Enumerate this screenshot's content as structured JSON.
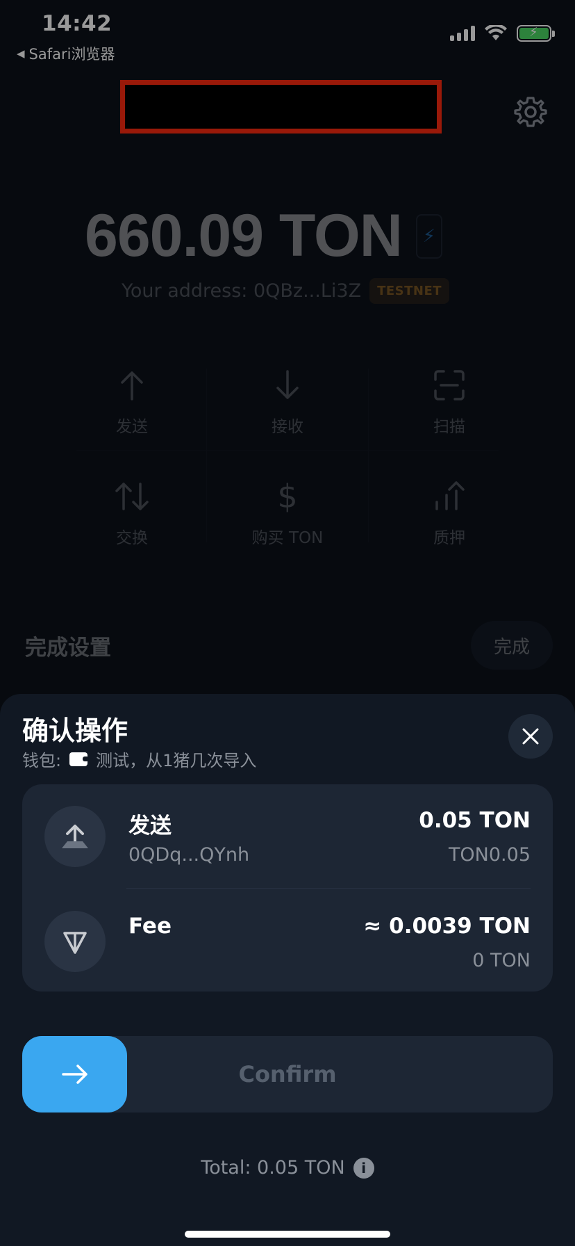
{
  "status_bar": {
    "time": "14:42",
    "back_app": "Safari浏览器",
    "battery_color": "#4cd964"
  },
  "wallet": {
    "balance": "660.09 TON",
    "address_label": "Your address: 0QBz...Li3Z",
    "network_badge": "TESTNET",
    "actions": [
      {
        "label": "发送",
        "icon": "arrow-up-icon"
      },
      {
        "label": "接收",
        "icon": "arrow-down-icon"
      },
      {
        "label": "扫描",
        "icon": "scan-icon"
      },
      {
        "label": "交换",
        "icon": "swap-icon"
      },
      {
        "label": "购买 TON",
        "icon": "dollar-icon"
      },
      {
        "label": "质押",
        "icon": "stake-icon"
      }
    ],
    "setup_title": "完成设置",
    "setup_button": "完成"
  },
  "sheet": {
    "title": "确认操作",
    "wallet_prefix": "钱包:",
    "wallet_name": "测试，从1猪几次导入",
    "rows": [
      {
        "title": "发送",
        "subtitle": "0QDq...QYnh",
        "amount": "0.05 TON",
        "amount_sub": "TON0.05",
        "icon": "send-icon"
      },
      {
        "title": "Fee",
        "subtitle": "",
        "amount": "≈ 0.0039 TON",
        "amount_sub": "0 TON",
        "icon": "ton-logo-icon"
      }
    ],
    "confirm_label": "Confirm",
    "total": "Total: 0.05 TON"
  },
  "colors": {
    "accent": "#3aa7f0",
    "badge_text": "#e59a2f",
    "redaction_border": "#ff2a10"
  }
}
